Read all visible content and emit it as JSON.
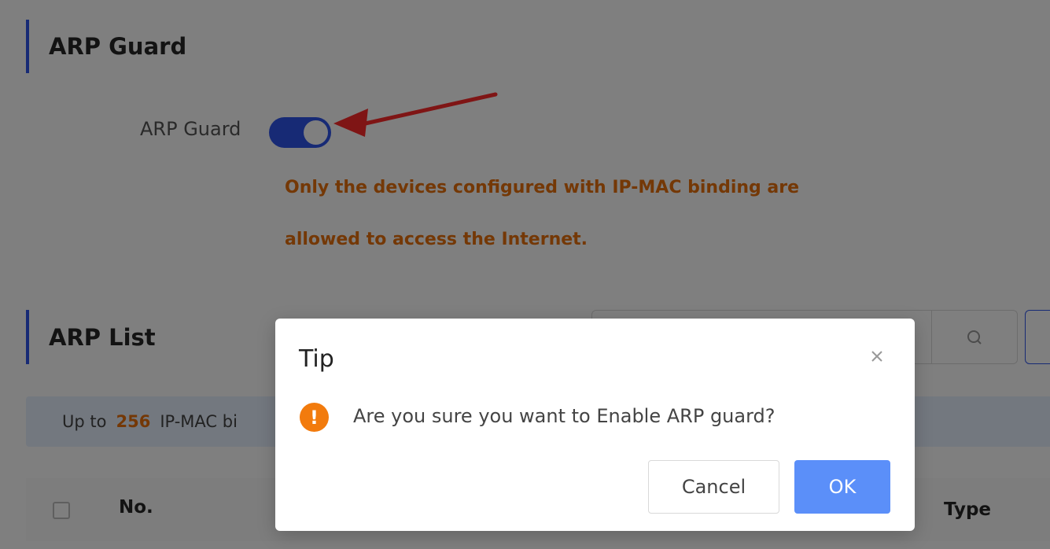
{
  "sections": {
    "arp_guard_title": "ARP Guard",
    "arp_list_title": "ARP List"
  },
  "arp_guard": {
    "label": "ARP Guard",
    "enabled": true,
    "warning_line1": "Only the devices configured with IP-MAC binding are",
    "warning_line2": "allowed to access the Internet."
  },
  "info_bar": {
    "prefix": "Up to",
    "count": "256",
    "suffix": "IP-MAC bi"
  },
  "table": {
    "col_no": "No.",
    "col_type": "Type"
  },
  "modal": {
    "title": "Tip",
    "message": "Are you sure you want to Enable ARP guard?",
    "icon_glyph": "!",
    "cancel_label": "Cancel",
    "ok_label": "OK"
  },
  "colors": {
    "accent": "#2f54eb",
    "warning": "#e8700c",
    "ok_button": "#5b8ff9",
    "annotation_arrow": "#ff2a2a"
  },
  "icons": {
    "search": "search-icon",
    "close": "close-icon",
    "alert": "exclamation-circle-icon"
  }
}
